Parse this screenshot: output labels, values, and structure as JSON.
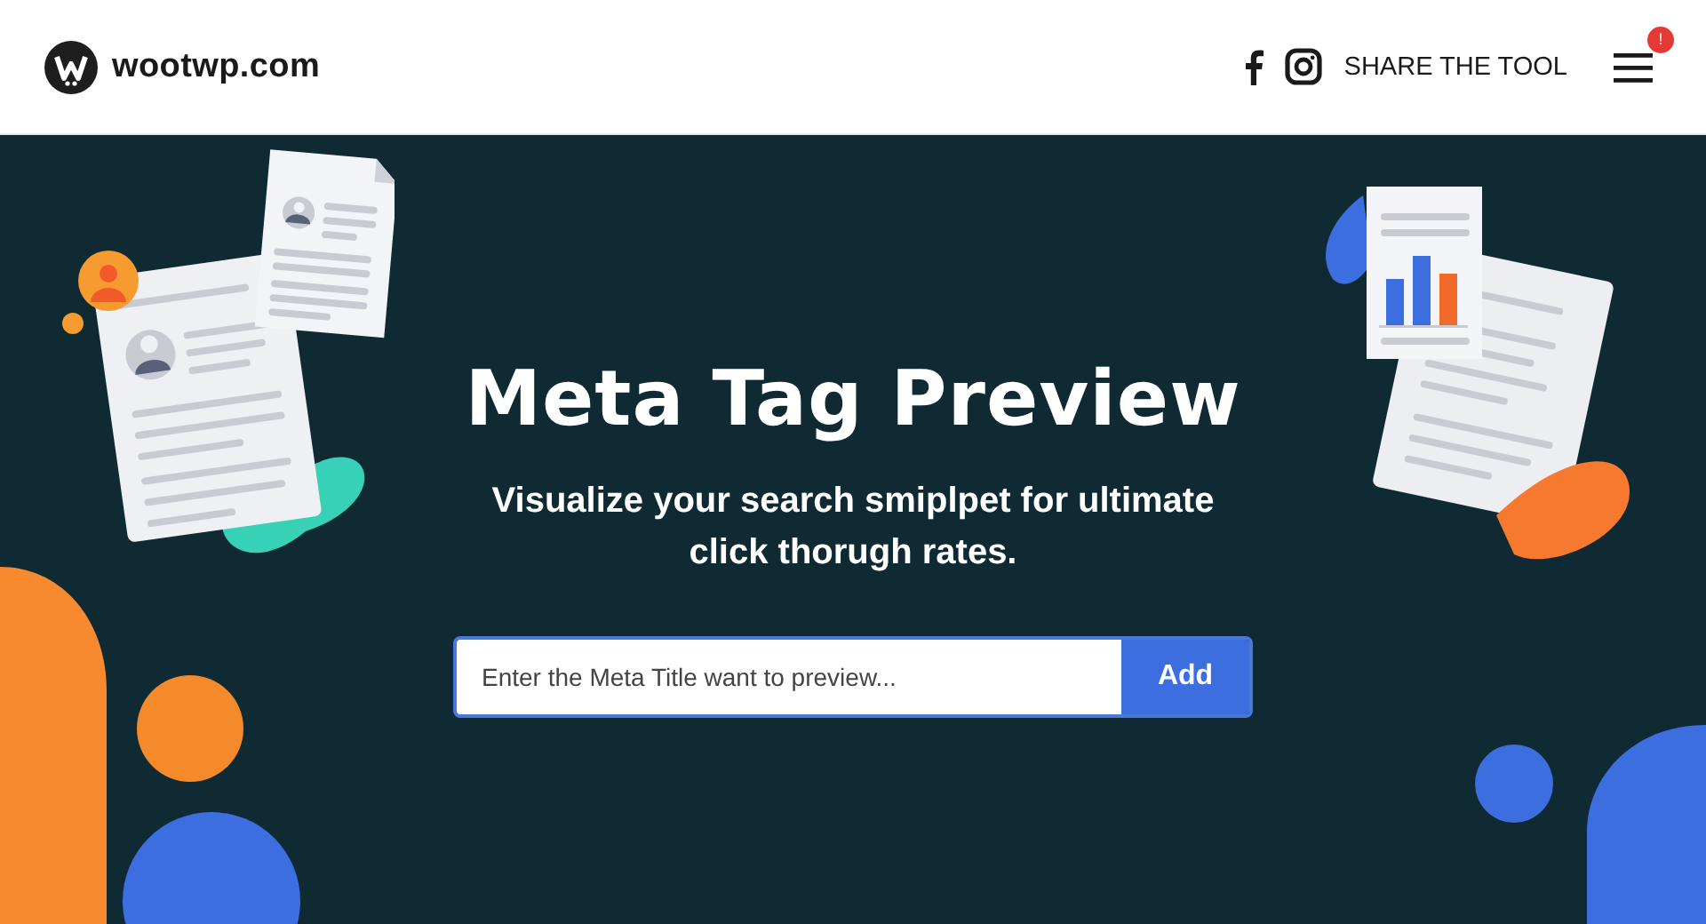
{
  "header": {
    "brand": "wootwp.com",
    "share_label": "SHARE THE TOOL",
    "menu_badge": "!"
  },
  "hero": {
    "title": "Meta Tag Preview",
    "subtitle": "Visualize your search smiplpet for ultimate click thorugh rates.",
    "search": {
      "placeholder": "Enter the Meta Title want to preview..."
    },
    "button": "Add"
  }
}
